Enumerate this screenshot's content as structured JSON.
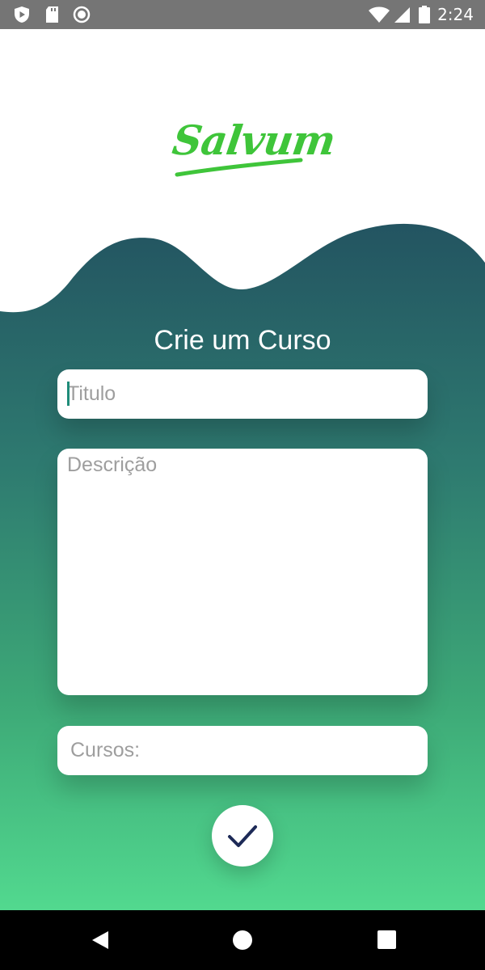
{
  "status_bar": {
    "time": "2:24",
    "icons": [
      "play-protect-icon",
      "sd-card-icon",
      "record-icon",
      "wifi-icon",
      "signal-icon",
      "battery-icon"
    ]
  },
  "logo": {
    "text": "Salvum",
    "color": "#3fc53a"
  },
  "form": {
    "title": "Crie um Curso",
    "title_placeholder": "Titulo",
    "description_placeholder": "Descrição",
    "courses_placeholder": "Cursos:"
  },
  "theme": {
    "gradient_top": "#235461",
    "gradient_bottom": "#52d98f",
    "check_color": "#1d2a57"
  },
  "nav_bar": {
    "icons": [
      "back-icon",
      "home-icon",
      "recents-icon"
    ]
  }
}
